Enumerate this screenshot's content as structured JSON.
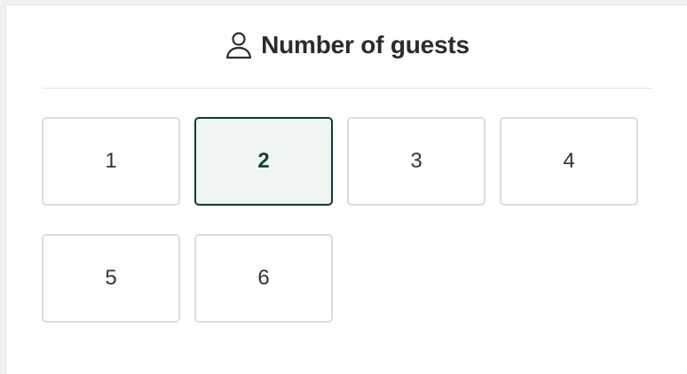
{
  "guests": {
    "title": "Number of guests",
    "icon": "person-icon",
    "options": [
      "1",
      "2",
      "3",
      "4",
      "5",
      "6"
    ],
    "selected": "2"
  },
  "colors": {
    "selected_border": "#0f3b33",
    "selected_background": "#eff5f3",
    "option_border": "#dcdcdc"
  }
}
